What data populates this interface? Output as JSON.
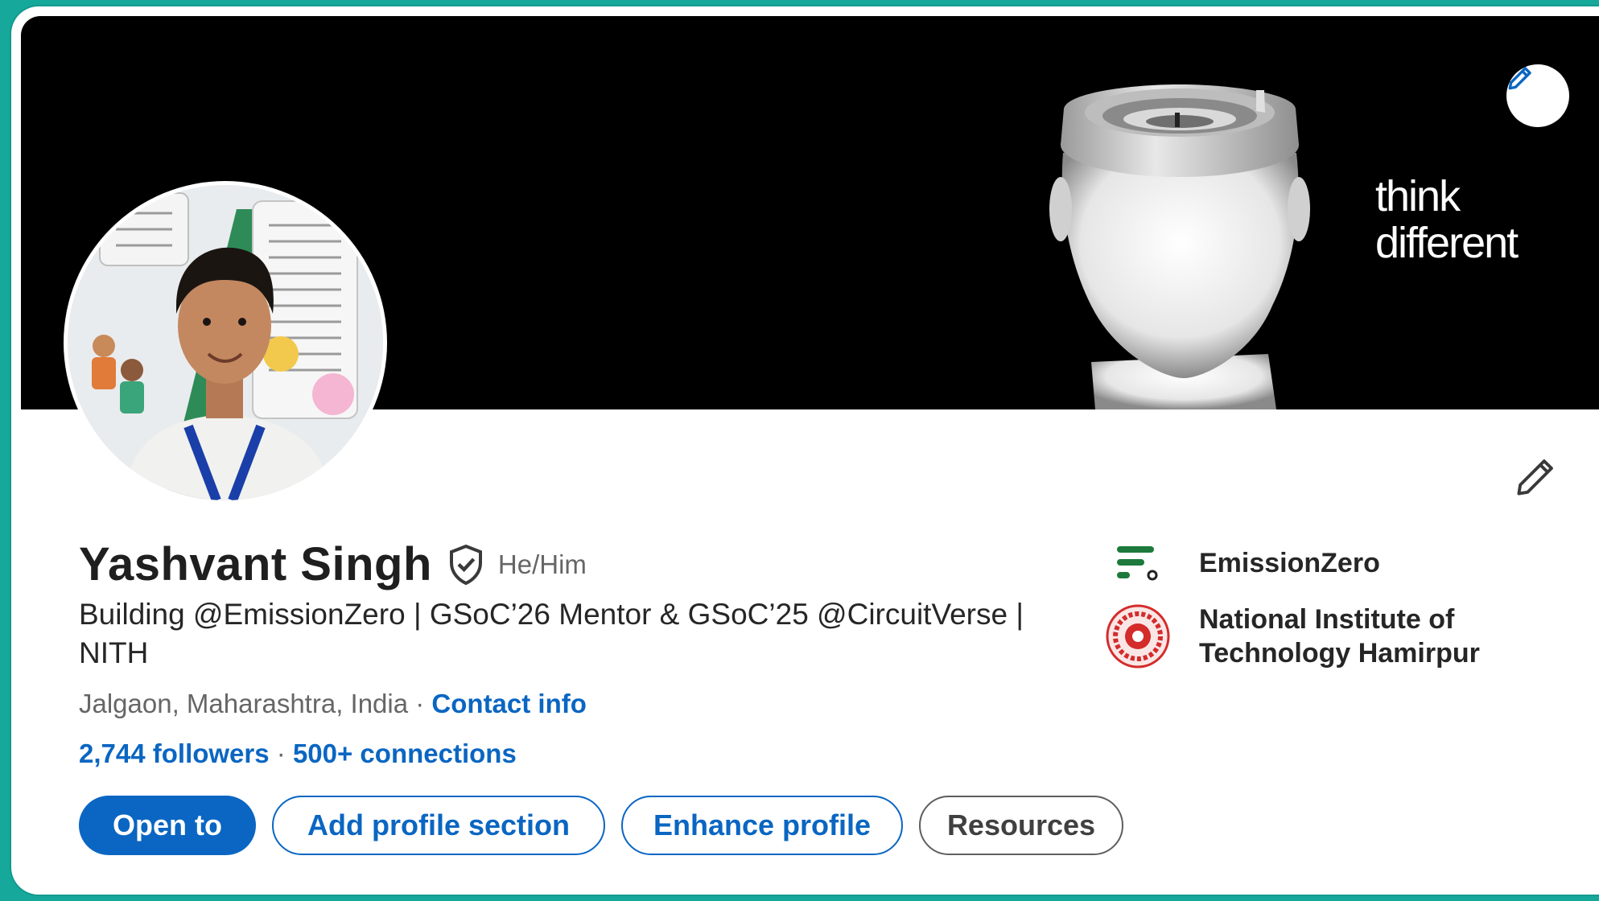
{
  "banner": {
    "tagline_line1": "think",
    "tagline_line2": "different",
    "edit_icon": "pencil-icon"
  },
  "profile": {
    "name": "Yashvant Singh",
    "verified_icon": "verified-shield-icon",
    "pronouns": "He/Him",
    "headline": "Building @EmissionZero | GSoC’26 Mentor & GSoC’25 @CircuitVerse | NITH",
    "location": "Jalgaon, Maharashtra, India",
    "separator": " · ",
    "contact_info": "Contact info",
    "followers": "2,744 followers",
    "connections": "500+ connections"
  },
  "actions": {
    "open_to": "Open to",
    "add_profile_section": "Add profile section",
    "enhance_profile": "Enhance profile",
    "resources": "Resources"
  },
  "affiliations": [
    {
      "label": "EmissionZero",
      "icon": "emissionzero-logo"
    },
    {
      "label": "National Institute of Technology Hamirpur",
      "icon": "nith-logo"
    }
  ],
  "colors": {
    "accent": "#0a66c2",
    "page_bg": "#15a89b",
    "banner_bg": "#000000",
    "emissionzero_green": "#1e7a3c",
    "nith_red": "#d42b2b"
  }
}
